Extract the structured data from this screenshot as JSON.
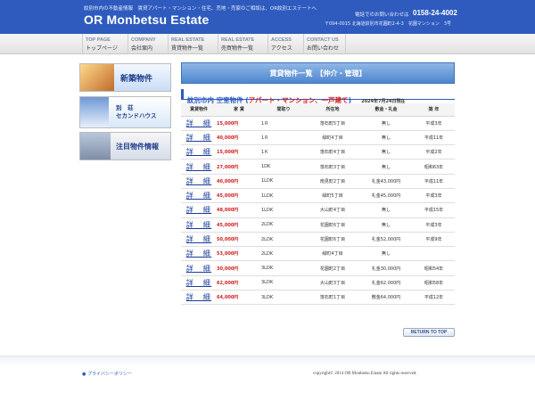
{
  "header": {
    "tagline": "紋別市内の不動産情報　賃貸アパート・マンション・住宅、売地・売家のご相談は、OR紋別エステートへ",
    "logo": "OR Monbetsu Estate",
    "tel_label": "電話でのお問い合わせは",
    "tel_number": "0158-24-4002",
    "address": "〒094-0015 北海道紋別市花園町2-4-3　花園マンション　3号"
  },
  "nav": [
    {
      "en": "TOP PAGE",
      "jp": "トップページ"
    },
    {
      "en": "COMPANY",
      "jp": "会社案内"
    },
    {
      "en": "REAL ESTATE",
      "jp": "賃貸物件一覧"
    },
    {
      "en": "REAL ESTATE",
      "jp": "売買物件一覧"
    },
    {
      "en": "ACCESS",
      "jp": "アクセス"
    },
    {
      "en": "CONTACT US",
      "jp": "お問い合わせ"
    }
  ],
  "sidebar": {
    "banner_new": "新築物件",
    "banner_villa_line1": "別　荘",
    "banner_villa_line2": "セカンドハウス",
    "banner_featured": "注目物件情報"
  },
  "content": {
    "title": "賃貸物件一覧　【仲介・管理】",
    "subhead_main": "紋別市内 空室物件 (",
    "subhead_red": "アパート・マンション、一戸建て",
    "subhead_close": ")",
    "subhead_date": "2024年7月24日現在",
    "columns": [
      "賃貸物件",
      "家 賃",
      "間取り",
      "所在地",
      "敷金・礼金",
      "築 年"
    ],
    "detail_label": "詳　細",
    "rows": [
      {
        "rent": "15,000円",
        "layout": "1Ｒ",
        "location": "落石町5丁目",
        "deposit": "無し",
        "built": "平成3年"
      },
      {
        "rent": "40,000円",
        "layout": "1Ｒ",
        "location": "緑町4丁目",
        "deposit": "無し",
        "built": "平成11年"
      },
      {
        "rent": "15,000円",
        "layout": "1Ｋ",
        "location": "落石町4丁目",
        "deposit": "無し",
        "built": "平成2年"
      },
      {
        "rent": "27,000円",
        "layout": "1DK",
        "location": "落石町3丁目",
        "deposit": "無し",
        "built": "昭和63年"
      },
      {
        "rent": "40,000円",
        "layout": "1LDK",
        "location": "南見町2丁目",
        "deposit": "礼金43,000円",
        "built": "平成11年"
      },
      {
        "rent": "45,000円",
        "layout": "1LDK",
        "location": "緑町5丁目",
        "deposit": "礼金45,000円",
        "built": "平成3年"
      },
      {
        "rent": "48,000円",
        "layout": "1LDK",
        "location": "大山町4丁目",
        "deposit": "無し",
        "built": "平成15年"
      },
      {
        "rent": "45,000円",
        "layout": "2LDK",
        "location": "花園町6丁目",
        "deposit": "無し",
        "built": "平成3年"
      },
      {
        "rent": "50,000円",
        "layout": "2LDK",
        "location": "花園町6丁目",
        "deposit": "礼金52,000円",
        "built": "平成9年"
      },
      {
        "rent": "53,000円",
        "layout": "2LDK",
        "location": "緑町4丁目",
        "deposit": "無し",
        "built": ""
      },
      {
        "rent": "30,000円",
        "layout": "3LDK",
        "location": "花園町2丁目",
        "deposit": "礼金30,000円",
        "built": "昭和54年"
      },
      {
        "rent": "62,000円",
        "layout": "3LDK",
        "location": "大山町3丁目",
        "deposit": "礼金62,000円",
        "built": "昭和58年"
      },
      {
        "rent": "64,000円",
        "layout": "3LDK",
        "location": "落石町1丁目",
        "deposit": "敷金64,000円",
        "built": "平成12年"
      }
    ],
    "return_label": "RETURN TO TOP"
  },
  "footer": {
    "privacy": "● プライバシーポリシー",
    "copyright": "copyright© 2014  OR Monbetsu Estate All rights reserved."
  },
  "colors": {
    "header_blue": "#2e5bbd",
    "rent_red": "#d11c1c",
    "title_bar": "#4d86cf"
  }
}
